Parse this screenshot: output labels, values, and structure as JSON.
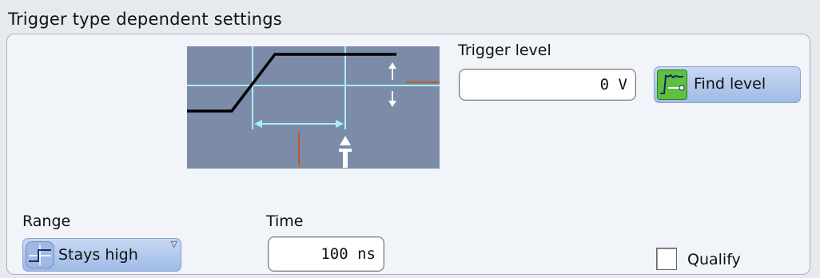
{
  "section": {
    "title": "Trigger type dependent settings"
  },
  "trigger_level": {
    "label": "Trigger level",
    "value": "0 V"
  },
  "find_level": {
    "label": "Find level",
    "icon": "waveform-find-icon"
  },
  "range": {
    "label": "Range",
    "value": "Stays high",
    "icon": "rising-step-icon"
  },
  "time": {
    "label": "Time",
    "value": "100 ns"
  },
  "qualify": {
    "label": "Qualify",
    "checked": false
  },
  "diagram": {
    "trigger_marker": "T"
  },
  "colors": {
    "diagram_bg": "#7c8ba8",
    "guide": "#a8f0f0",
    "signal": "#000000",
    "level_mark": "#c05a28",
    "button_gradient_top": "#c8d8f4",
    "button_gradient_bottom": "#9fbbe6",
    "icon_green": "#5fbf3f"
  }
}
